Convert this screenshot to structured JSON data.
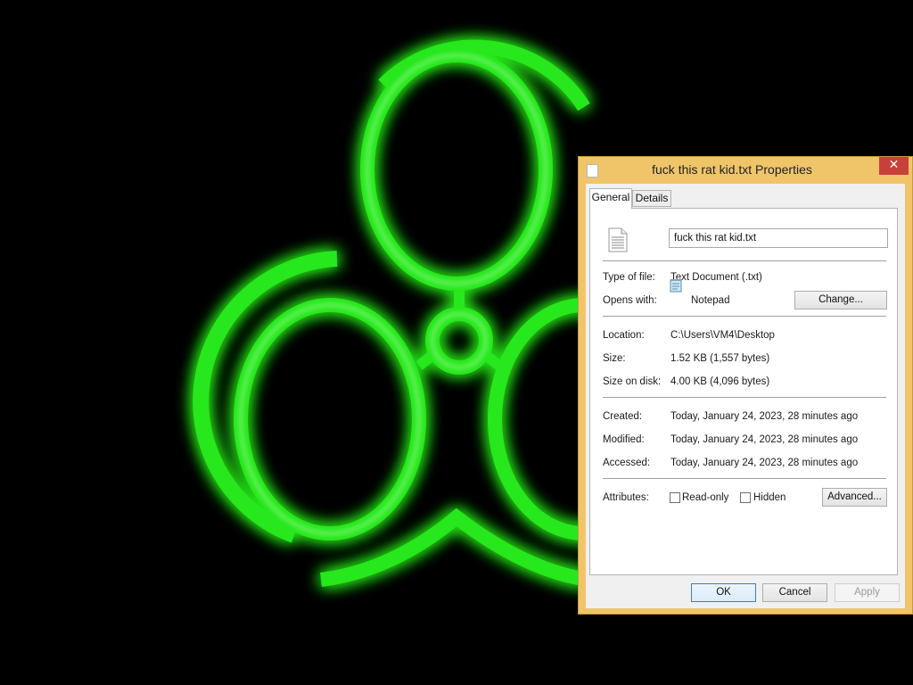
{
  "wallpaper": {
    "icon": "biohazard-symbol",
    "glow_color": "#27e81c",
    "background": "#000000"
  },
  "dialog": {
    "title": "fuck this rat kid.txt Properties",
    "close_glyph": "✕",
    "accent_color": "#f0c56a",
    "close_color": "#c7413a",
    "tabs": [
      "General",
      "Details"
    ],
    "active_tab": "General",
    "file_name": "fuck this rat kid.txt",
    "type_label": "Type of file:",
    "type_value": "Text Document (.txt)",
    "opens_label": "Opens with:",
    "opens_value": "Notepad",
    "change_button": "Change...",
    "location_label": "Location:",
    "location_value": "C:\\Users\\VM4\\Desktop",
    "size_label": "Size:",
    "size_value": "1.52 KB (1,557 bytes)",
    "size_disk_label": "Size on disk:",
    "size_disk_value": "4.00 KB (4,096 bytes)",
    "created_label": "Created:",
    "created_value": "Today, January 24, 2023, 28 minutes ago",
    "modified_label": "Modified:",
    "modified_value": "Today, January 24, 2023, 28 minutes ago",
    "accessed_label": "Accessed:",
    "accessed_value": "Today, January 24, 2023, 28 minutes ago",
    "attributes_label": "Attributes:",
    "readonly_label": "Read-only",
    "readonly_checked": false,
    "hidden_label": "Hidden",
    "hidden_checked": false,
    "advanced_button": "Advanced...",
    "ok_button": "OK",
    "cancel_button": "Cancel",
    "apply_button": "Apply"
  }
}
